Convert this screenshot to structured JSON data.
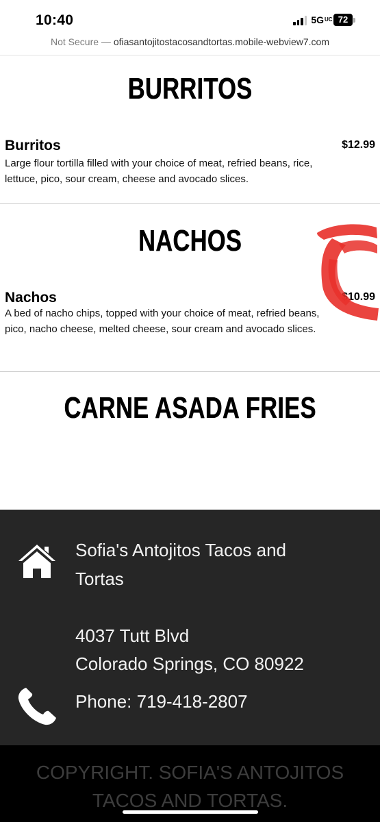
{
  "status_bar": {
    "time": "10:40",
    "network": "5G",
    "network_sub": "UC",
    "battery": "72"
  },
  "url_bar": {
    "security": "Not Secure —",
    "host": "ofiasantojitostacosandtortas.mobile-webview7.com"
  },
  "menu": {
    "burritos": {
      "title": "BURRITOS",
      "item_name": "Burritos",
      "item_price": "$12.99",
      "item_desc": "Large flour tortilla filled with your choice of meat, refried beans, rice, lettuce, pico, sour cream, cheese and avocado slices."
    },
    "nachos": {
      "title": "NACHOS",
      "item_name": "Nachos",
      "item_price": "$10.99",
      "item_desc": "A bed of nacho chips, topped with your choice of meat, refried beans, pico, nacho cheese, melted cheese, sour cream and avocado slices."
    },
    "carne_asada_fries": {
      "title": "CARNE ASADA FRIES"
    }
  },
  "footer": {
    "business_name_line1": "Sofia's Antojitos Tacos and",
    "business_name_line2": "Tortas",
    "address_line1": "4037 Tutt Blvd",
    "address_line2": "Colorado Springs, CO 80922",
    "phone": "Phone: 719-418-2807",
    "home_icon": "home-icon",
    "phone_icon": "phone-icon"
  },
  "copyright": {
    "line1": "COPYRIGHT. SOFIA'S ANTOJITOS",
    "line2": "TACOS AND TORTAS."
  },
  "colors": {
    "footer_bg": "#262626",
    "copyright_bg": "#000000",
    "scribble": "#e8302a"
  }
}
